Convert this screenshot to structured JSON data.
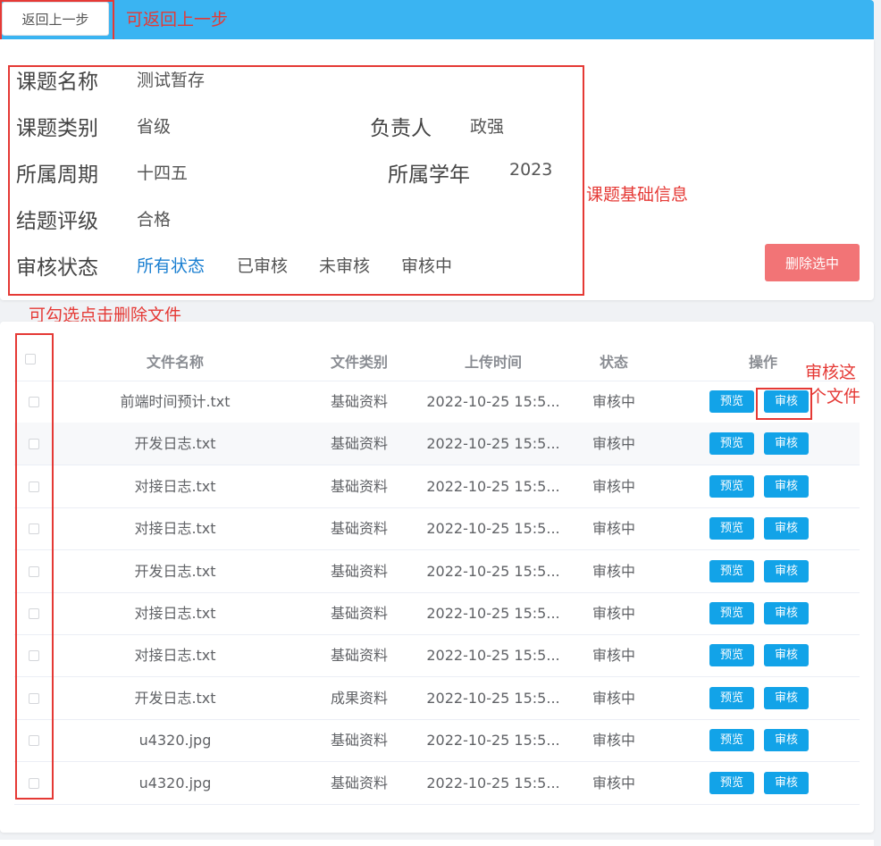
{
  "topbar": {
    "back_label": "返回上一步"
  },
  "info": {
    "name_label": "课题名称",
    "name_value": "测试暂存",
    "category_label": "课题类别",
    "category_value": "省级",
    "owner_label": "负责人",
    "owner_value": "政强",
    "period_label": "所属周期",
    "period_value": "十四五",
    "year_label": "所属学年",
    "year_value": "2023",
    "grade_label": "结题评级",
    "grade_value": "合格",
    "status_label": "审核状态",
    "status_filters": [
      "所有状态",
      "已审核",
      "未审核",
      "审核中"
    ],
    "active_filter": "所有状态",
    "delete_label": "删除选中"
  },
  "table": {
    "headers": {
      "name": "文件名称",
      "category": "文件类别",
      "time": "上传时间",
      "status": "状态",
      "actions": "操作"
    },
    "preview_label": "预览",
    "review_label": "审核",
    "rows": [
      {
        "name": "前端时间预计.txt",
        "category": "基础资料",
        "time": "2022-10-25 15:5...",
        "status": "审核中"
      },
      {
        "name": "开发日志.txt",
        "category": "基础资料",
        "time": "2022-10-25 15:5...",
        "status": "审核中"
      },
      {
        "name": "对接日志.txt",
        "category": "基础资料",
        "time": "2022-10-25 15:5...",
        "status": "审核中"
      },
      {
        "name": "对接日志.txt",
        "category": "基础资料",
        "time": "2022-10-25 15:5...",
        "status": "审核中"
      },
      {
        "name": "开发日志.txt",
        "category": "基础资料",
        "time": "2022-10-25 15:5...",
        "status": "审核中"
      },
      {
        "name": "对接日志.txt",
        "category": "基础资料",
        "time": "2022-10-25 15:5...",
        "status": "审核中"
      },
      {
        "name": "对接日志.txt",
        "category": "基础资料",
        "time": "2022-10-25 15:5...",
        "status": "审核中"
      },
      {
        "name": "开发日志.txt",
        "category": "成果资料",
        "time": "2022-10-25 15:5...",
        "status": "审核中"
      },
      {
        "name": "u4320.jpg",
        "category": "基础资料",
        "time": "2022-10-25 15:5...",
        "status": "审核中"
      },
      {
        "name": "u4320.jpg",
        "category": "基础资料",
        "time": "2022-10-25 15:5...",
        "status": "审核中"
      }
    ]
  },
  "annotations": {
    "back": "可返回上一步",
    "info": "课题基础信息",
    "checkbox": "可勾选点击删除文件",
    "review_line1": "审核这",
    "review_line2": "个文件"
  },
  "colors": {
    "topbar": "#3ab4f2",
    "delete": "#f27476",
    "button": "#12a3e8",
    "annotation": "#e53935",
    "active_filter": "#1a7fd1"
  }
}
